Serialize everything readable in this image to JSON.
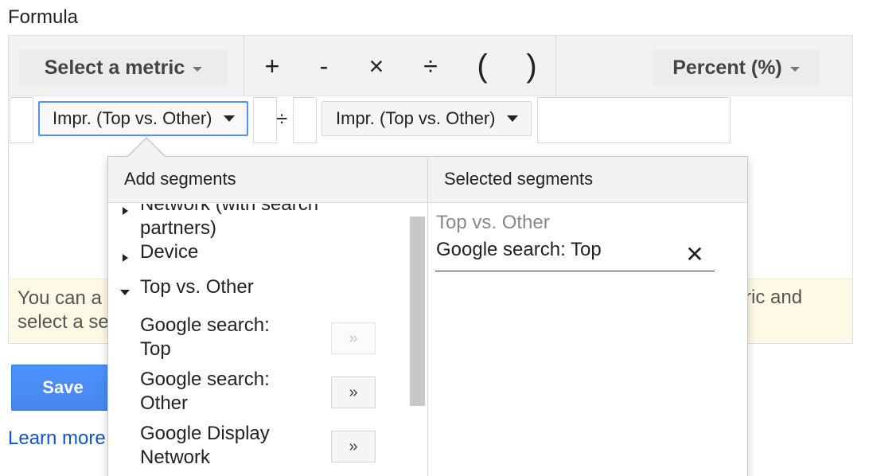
{
  "title": "Formula",
  "toolbar": {
    "metric_select_label": "Select a metric",
    "operators": [
      "+",
      "-",
      "×",
      "÷",
      "(",
      ")"
    ],
    "format_select_label": "Percent (%)"
  },
  "formula": {
    "left_metric": "Impr. (Top vs. Other)",
    "operator": "÷",
    "right_metric": "Impr. (Top vs. Other)"
  },
  "info_banner": {
    "line1": "You can a",
    "line2": "select a se",
    "right": "ric and"
  },
  "actions": {
    "save_label": "Save",
    "learn_more_label": "Learn more"
  },
  "segments_popup": {
    "add_title": "Add segments",
    "selected_title": "Selected segments",
    "tree": [
      {
        "label_line1": "Network (with search",
        "label_line2": "partners)",
        "expanded": false
      },
      {
        "label_line1": "Device",
        "expanded": false
      },
      {
        "label_line1": "Top vs. Other",
        "expanded": true,
        "children": [
          {
            "label_line1": "Google search:",
            "label_line2": "Top",
            "added": true
          },
          {
            "label_line1": "Google search:",
            "label_line2": "Other",
            "added": false
          },
          {
            "label_line1": "Google Display",
            "label_line2": "Network",
            "added": false
          }
        ]
      }
    ],
    "add_button_glyph": "»",
    "selected": {
      "group": "Top vs. Other",
      "item": "Google search: Top",
      "remove_glyph": "✕"
    }
  },
  "colors": {
    "accent_blue": "#4d90fe",
    "link_blue": "#1155cc",
    "banner_bg": "#fef9e4"
  }
}
